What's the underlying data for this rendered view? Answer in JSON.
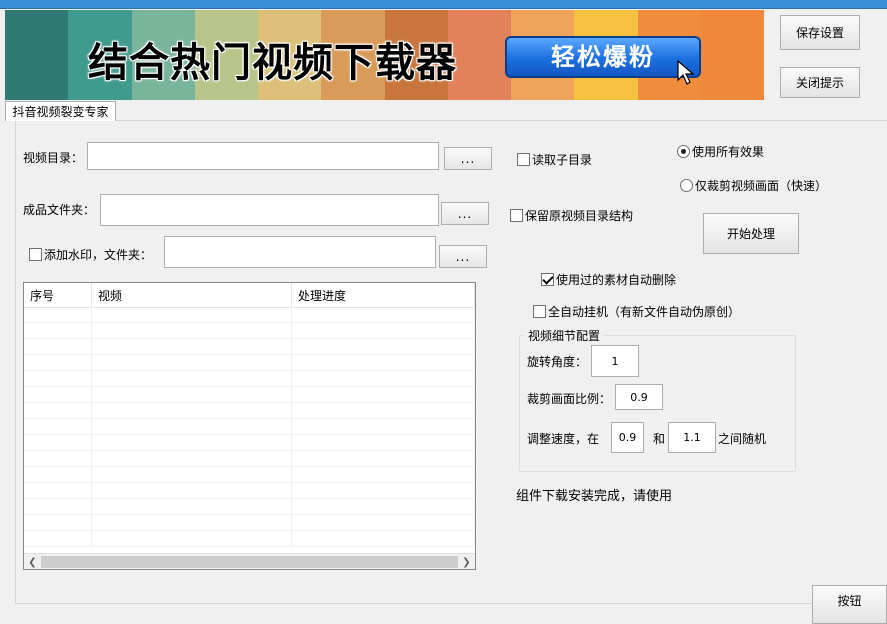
{
  "colors": {
    "stripes": [
      "#2f7a75",
      "#3f9b8d",
      "#79b59b",
      "#b7c58a",
      "#dcc07a",
      "#d99b58",
      "#c8763c",
      "#e2825a",
      "#f0a35a",
      "#f5c13f",
      "#f08d3c",
      "#f0883b"
    ],
    "banner_button": "#1b6fe0",
    "title_bar": "#3a8fd8"
  },
  "banner": {
    "title": "结合热门视频下载器",
    "button_label": "轻松爆粉",
    "cursor_icon": "arrow-cursor-icon"
  },
  "side_buttons": {
    "save_settings": "保存设置",
    "close_tips": "关闭提示"
  },
  "tab": {
    "label": "抖音视频裂变专家"
  },
  "form": {
    "video_dir_label": "视频目录：",
    "output_dir_label": "成品文件夹：",
    "watermark_label": "添加水印，文件夹：",
    "browse_label": "...",
    "video_dir_value": "",
    "output_dir_value": "",
    "watermark_dir_value": "",
    "watermark_checked": false
  },
  "options": {
    "read_subdir": "读取子目录",
    "read_subdir_checked": false,
    "keep_structure": "保留原视频目录结构",
    "keep_structure_checked": false,
    "use_all_effects": "使用所有效果",
    "use_all_effects_selected": true,
    "crop_only": "仅裁剪视频画面（快速）",
    "crop_only_selected": false,
    "auto_delete": "使用过的素材自动删除",
    "auto_delete_checked": true,
    "auto_hangup": "全自动挂机（有新文件自动伪原创）",
    "auto_hangup_checked": false
  },
  "start_button": "开始处理",
  "table": {
    "columns": [
      "序号",
      "视频",
      "处理进度"
    ],
    "rows": []
  },
  "details": {
    "group_title": "视频细节配置",
    "rotate_label": "旋转角度：",
    "rotate_value": "1",
    "crop_label": "裁剪画面比例：",
    "crop_value": "0.9",
    "speed_label": "调整速度，在",
    "speed_min": "0.9",
    "and_label": "和",
    "speed_max": "1.1",
    "random_label": "之间随机"
  },
  "status_text": "组件下载安装完成，请使用",
  "bottom_button": "按钮"
}
